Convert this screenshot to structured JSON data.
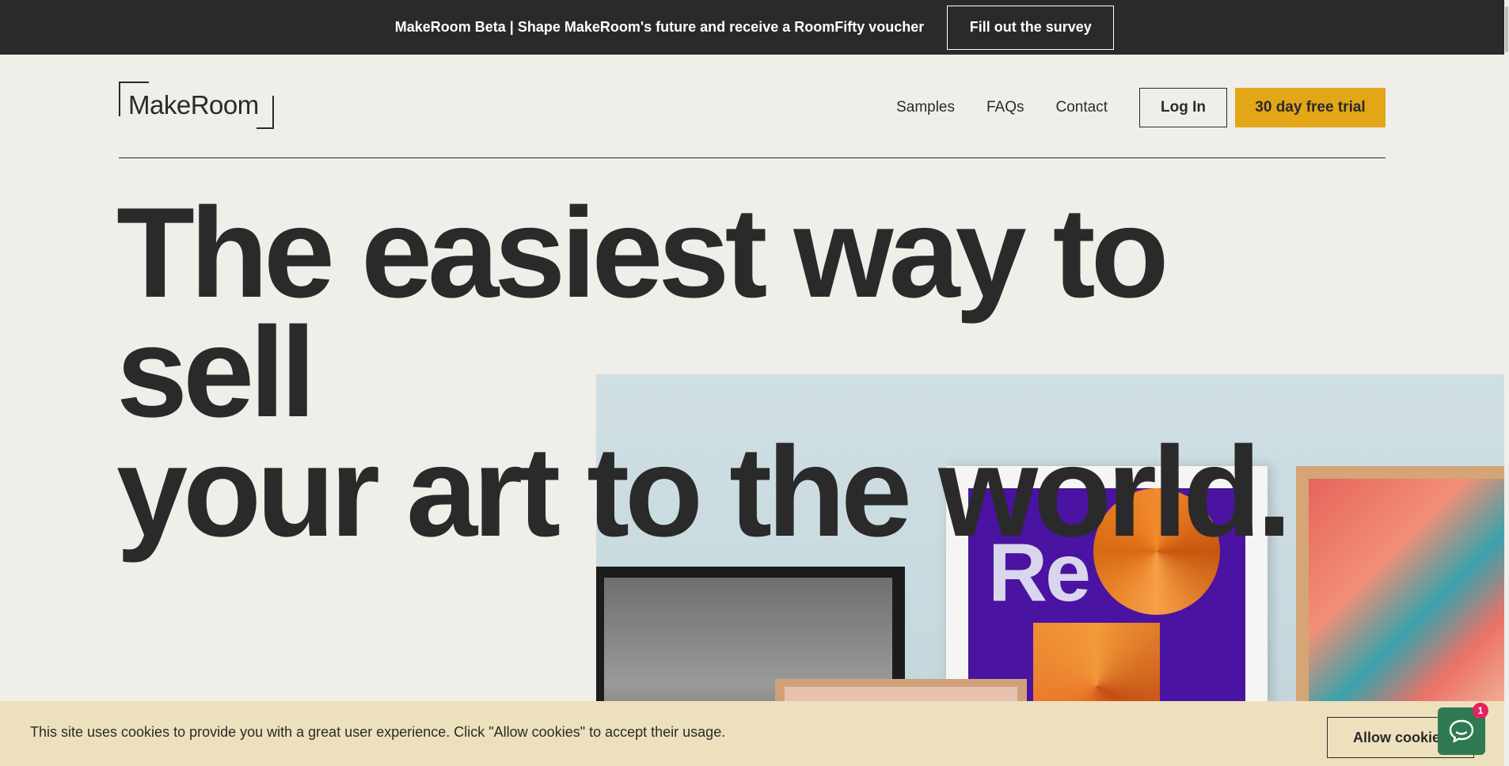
{
  "announcement": {
    "text": "MakeRoom Beta | Shape MakeRoom's future and receive a RoomFifty voucher",
    "button_label": "Fill out the survey"
  },
  "header": {
    "logo_text": "MakeRoom",
    "nav": [
      "Samples",
      "FAQs",
      "Contact"
    ],
    "login_label": "Log In",
    "trial_label": "30 day free trial"
  },
  "hero": {
    "headline_line1": "The easiest way to sell",
    "headline_line2": "your art to the world.",
    "image_print_text": "Re"
  },
  "cookie_banner": {
    "text": "This site uses cookies to provide you with a great user experience. Click \"Allow cookies\" to accept their usage.",
    "button_label": "Allow cookies"
  },
  "chat": {
    "badge_count": "1"
  },
  "colors": {
    "dark": "#2b2a2a",
    "background": "#f0eee8",
    "accent_yellow": "#e2a617",
    "cookie_bg": "#ede0bd",
    "chat_green": "#2f7a51",
    "badge_pink": "#e5245e"
  }
}
